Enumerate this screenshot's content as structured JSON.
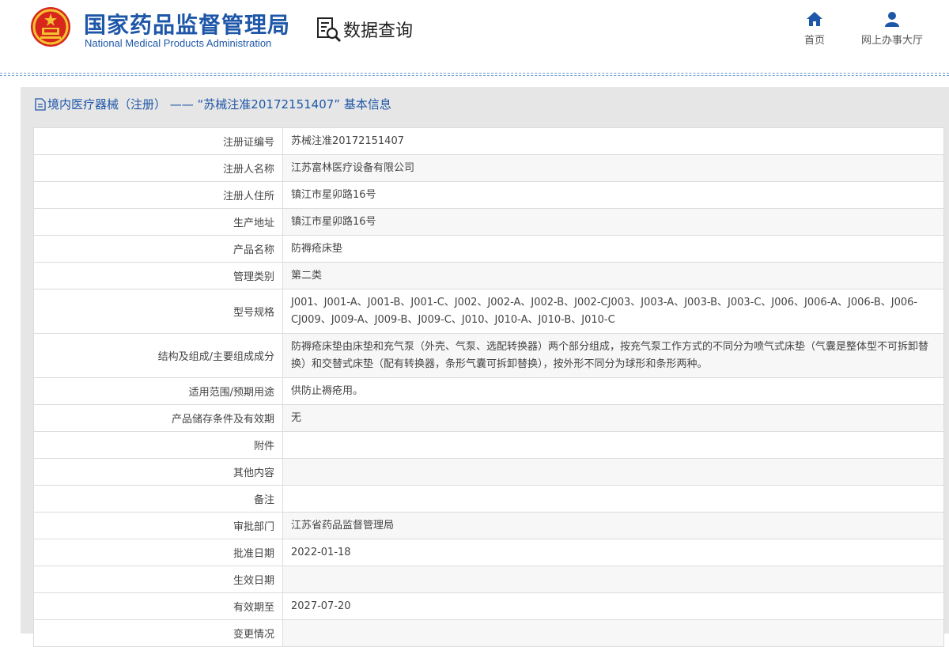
{
  "header": {
    "brand_cn": "国家药品监督管理局",
    "brand_en": "National Medical Products Administration",
    "query_label": "数据查询",
    "nav": {
      "home": "首页",
      "hall": "网上办事大厅"
    },
    "accent_color": "#1e57a8"
  },
  "breadcrumb": "境内医疗器械（注册） —— “苏械注准20172151407” 基本信息",
  "rows": [
    {
      "label": "注册证编号",
      "value": "苏械注准20172151407"
    },
    {
      "label": "注册人名称",
      "value": "江苏富林医疗设备有限公司"
    },
    {
      "label": "注册人住所",
      "value": "镇江市星卯路16号"
    },
    {
      "label": "生产地址",
      "value": "镇江市星卯路16号"
    },
    {
      "label": "产品名称",
      "value": "防褥疮床垫"
    },
    {
      "label": "管理类别",
      "value": "第二类"
    },
    {
      "label": "型号规格",
      "value": "J001、J001-A、J001-B、J001-C、J002、J002-A、J002-B、J002-CJ003、J003-A、J003-B、J003-C、J006、J006-A、J006-B、J006-CJ009、J009-A、J009-B、J009-C、J010、J010-A、J010-B、J010-C"
    },
    {
      "label": "结构及组成/主要组成成分",
      "value": "防褥疮床垫由床垫和充气泵（外壳、气泵、选配转换器）两个部分组成，按充气泵工作方式的不同分为喷气式床垫（气囊是整体型不可拆卸替换）和交替式床垫（配有转换器，条形气囊可拆卸替换），按外形不同分为球形和条形两种。"
    },
    {
      "label": "适用范围/预期用途",
      "value": "供防止褥疮用。"
    },
    {
      "label": "产品储存条件及有效期",
      "value": "无"
    },
    {
      "label": "附件",
      "value": ""
    },
    {
      "label": "其他内容",
      "value": ""
    },
    {
      "label": "备注",
      "value": ""
    },
    {
      "label": "审批部门",
      "value": "江苏省药品监督管理局"
    },
    {
      "label": "批准日期",
      "value": "2022-01-18"
    },
    {
      "label": "生效日期",
      "value": ""
    },
    {
      "label": "有效期至",
      "value": "2027-07-20"
    },
    {
      "label": "变更情况",
      "value": ""
    }
  ]
}
